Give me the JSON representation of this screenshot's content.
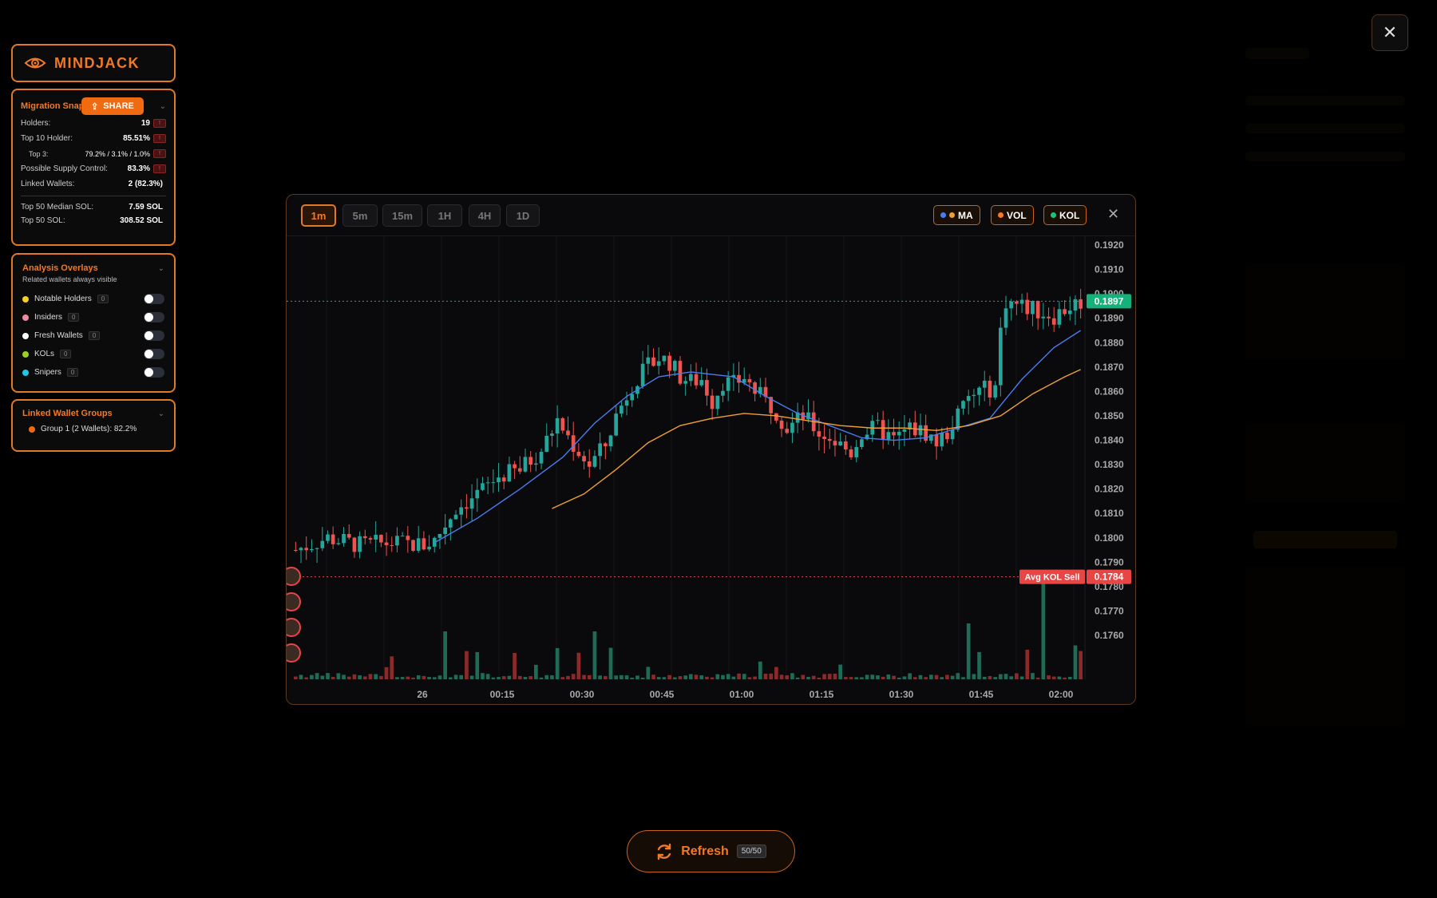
{
  "app": {
    "brand": "MINDJACK"
  },
  "snapshot": {
    "title": "Migration Snap",
    "share_label": "SHARE",
    "rows": [
      {
        "label": "Holders:",
        "value": "19",
        "flag": true
      },
      {
        "label": "Top 10 Holder:",
        "value": "85.51%",
        "flag": true
      },
      {
        "label": "Top 3:",
        "value": "79.2% / 3.1% / 1.0%",
        "flag": true,
        "sub": true
      },
      {
        "label": "Possible Supply Control:",
        "value": "83.3%",
        "flag": true
      },
      {
        "label": "Linked Wallets:",
        "value": "2 (82.3%)",
        "flag": false
      }
    ],
    "rows2": [
      {
        "label": "Top 50 Median SOL:",
        "value": "7.59 SOL"
      },
      {
        "label": "Top 50 SOL:",
        "value": "308.52 SOL"
      }
    ]
  },
  "overlays": {
    "title": "Analysis Overlays",
    "subtitle": "Related wallets always visible",
    "items": [
      {
        "label": "Notable Holders",
        "count": "0",
        "color": "#f5d020",
        "enabled": false
      },
      {
        "label": "Insiders",
        "count": "0",
        "color": "#f08aa0",
        "enabled": false
      },
      {
        "label": "Fresh Wallets",
        "count": "0",
        "color": "#ffffff",
        "enabled": false
      },
      {
        "label": "KOLs",
        "count": "0",
        "color": "#9ad020",
        "enabled": false
      },
      {
        "label": "Snipers",
        "count": "0",
        "color": "#20c8e8",
        "enabled": false
      }
    ]
  },
  "linked_groups": {
    "title": "Linked Wallet Groups",
    "items": [
      {
        "label": "Group 1 (2 Wallets): 82.2%",
        "color": "#f06a12"
      }
    ]
  },
  "chart_controls": {
    "timeframes": [
      "1m",
      "5m",
      "15m",
      "1H",
      "4H",
      "1D"
    ],
    "active_timeframe": "1m",
    "indicators": [
      {
        "label": "MA",
        "dots": [
          "#4a7cf0",
          "#f0a030"
        ]
      },
      {
        "label": "VOL",
        "dots": [
          "#f07a28"
        ]
      },
      {
        "label": "KOL",
        "dots": [
          "#20c080"
        ]
      }
    ]
  },
  "chart_data": {
    "type": "candlestick",
    "x_ticks": [
      "26",
      "00:15",
      "00:30",
      "00:45",
      "01:00",
      "01:15",
      "01:30",
      "01:45",
      "02:00"
    ],
    "y_ticks": [
      "0.1920",
      "0.1910",
      "0.1900",
      "0.1890",
      "0.1880",
      "0.1870",
      "0.1860",
      "0.1850",
      "0.1840",
      "0.1830",
      "0.1820",
      "0.1810",
      "0.1800",
      "0.1790",
      "0.1780",
      "0.1770",
      "0.1760"
    ],
    "ylim": [
      0.176,
      0.1921
    ],
    "last_price": {
      "label": "0.1897",
      "value": 0.1897
    },
    "avg_kol_sell": {
      "label": "Avg KOL Sell",
      "price_label": "0.1784",
      "value": 0.1784
    },
    "colors": {
      "up": "#26a69a",
      "down": "#ef5350",
      "ma_fast": "#4a7cf0",
      "ma_slow": "#f0a030",
      "kol_line": "#e84a4a"
    },
    "price_path": [
      [
        0,
        0.1795
      ],
      [
        6,
        0.18
      ],
      [
        12,
        0.1797
      ],
      [
        18,
        0.1798
      ],
      [
        24,
        0.1797
      ],
      [
        26,
        0.1799
      ],
      [
        30,
        0.1812
      ],
      [
        34,
        0.1818
      ],
      [
        38,
        0.1825
      ],
      [
        42,
        0.1828
      ],
      [
        46,
        0.1836
      ],
      [
        49,
        0.1848
      ],
      [
        52,
        0.1838
      ],
      [
        55,
        0.183
      ],
      [
        58,
        0.1838
      ],
      [
        60,
        0.185
      ],
      [
        63,
        0.1863
      ],
      [
        66,
        0.187
      ],
      [
        68,
        0.1874
      ],
      [
        70,
        0.1872
      ],
      [
        72,
        0.1866
      ],
      [
        74,
        0.1864
      ],
      [
        76,
        0.1865
      ],
      [
        78,
        0.1856
      ],
      [
        80,
        0.1864
      ],
      [
        82,
        0.1863
      ],
      [
        84,
        0.1866
      ],
      [
        86,
        0.186
      ],
      [
        88,
        0.1856
      ],
      [
        90,
        0.1852
      ],
      [
        92,
        0.1845
      ],
      [
        95,
        0.185
      ],
      [
        98,
        0.1843
      ],
      [
        100,
        0.1841
      ],
      [
        102,
        0.1838
      ],
      [
        104,
        0.1835
      ],
      [
        106,
        0.1843
      ],
      [
        109,
        0.1845
      ],
      [
        112,
        0.184
      ],
      [
        115,
        0.1845
      ],
      [
        118,
        0.1843
      ],
      [
        120,
        0.1839
      ],
      [
        122,
        0.1843
      ],
      [
        124,
        0.185
      ],
      [
        126,
        0.1857
      ],
      [
        128,
        0.186
      ],
      [
        131,
        0.1862
      ],
      [
        132,
        0.1885
      ],
      [
        133,
        0.1897
      ],
      [
        136,
        0.1895
      ],
      [
        139,
        0.1893
      ],
      [
        142,
        0.1891
      ],
      [
        145,
        0.1895
      ],
      [
        147,
        0.1897
      ]
    ],
    "ma_fast": [
      [
        26,
        0.1798
      ],
      [
        34,
        0.1808
      ],
      [
        42,
        0.182
      ],
      [
        50,
        0.1833
      ],
      [
        56,
        0.1847
      ],
      [
        62,
        0.1858
      ],
      [
        68,
        0.1866
      ],
      [
        74,
        0.1868
      ],
      [
        82,
        0.1866
      ],
      [
        88,
        0.1858
      ],
      [
        94,
        0.1851
      ],
      [
        100,
        0.1846
      ],
      [
        106,
        0.1841
      ],
      [
        112,
        0.184
      ],
      [
        118,
        0.1841
      ],
      [
        124,
        0.1845
      ],
      [
        130,
        0.1849
      ],
      [
        136,
        0.1865
      ],
      [
        142,
        0.1878
      ],
      [
        147,
        0.1885
      ]
    ],
    "ma_slow": [
      [
        48,
        0.1812
      ],
      [
        54,
        0.1818
      ],
      [
        60,
        0.1828
      ],
      [
        66,
        0.1839
      ],
      [
        72,
        0.1846
      ],
      [
        78,
        0.1849
      ],
      [
        84,
        0.1851
      ],
      [
        90,
        0.185
      ],
      [
        96,
        0.1848
      ],
      [
        102,
        0.1846
      ],
      [
        108,
        0.1845
      ],
      [
        114,
        0.1845
      ],
      [
        120,
        0.1844
      ],
      [
        126,
        0.1846
      ],
      [
        132,
        0.185
      ],
      [
        138,
        0.1859
      ],
      [
        144,
        0.1866
      ],
      [
        147,
        0.1869
      ]
    ]
  },
  "refresh": {
    "label": "Refresh",
    "count": "50/50"
  }
}
